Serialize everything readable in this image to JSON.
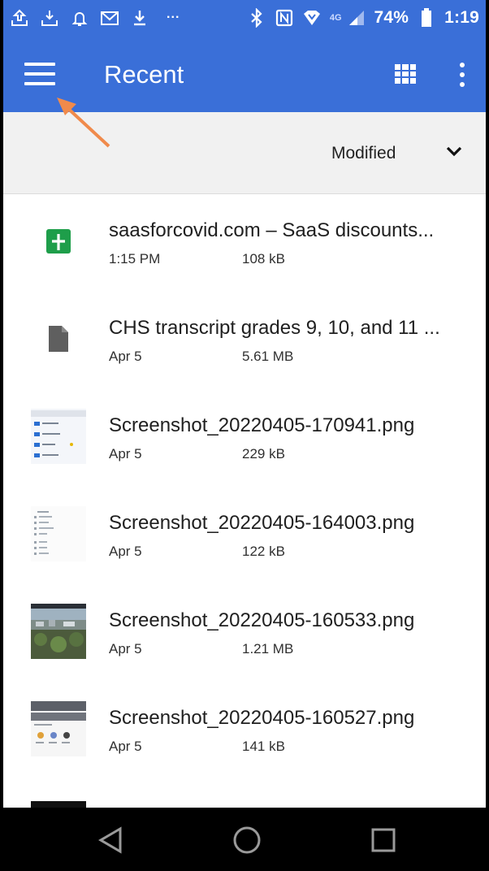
{
  "status_bar": {
    "battery": "74%",
    "time": "1:19",
    "network": "4G",
    "icons": [
      "upload-icon",
      "download-box-icon",
      "bell-icon",
      "gmail-icon",
      "download-icon",
      "more-dots-icon",
      "bluetooth-icon",
      "nfc-icon",
      "location-icon",
      "signal-icon",
      "battery-icon"
    ],
    "overflow_label": "···"
  },
  "app_bar": {
    "title": "Recent",
    "menu_icon": "hamburger-menu-icon",
    "grid_icon": "grid-view-icon",
    "more_icon": "more-vert-icon",
    "color": "#3a6fd8"
  },
  "sort": {
    "label": "Modified",
    "icon": "chevron-down-icon"
  },
  "files": [
    {
      "name": "saasforcovid.com – SaaS discounts...",
      "date": "1:15 PM",
      "size": "108 kB",
      "icon": "google-sheets-icon"
    },
    {
      "name": "CHS transcript grades 9, 10, and 11 ...",
      "date": "Apr 5",
      "size": "5.61 MB",
      "icon": "document-file-icon"
    },
    {
      "name": "Screenshot_20220405-170941.png",
      "date": "Apr 5",
      "size": "229 kB",
      "icon": "image-thumbnail"
    },
    {
      "name": "Screenshot_20220405-164003.png",
      "date": "Apr 5",
      "size": "122 kB",
      "icon": "image-thumbnail"
    },
    {
      "name": "Screenshot_20220405-160533.png",
      "date": "Apr 5",
      "size": "1.21 MB",
      "icon": "image-thumbnail"
    },
    {
      "name": "Screenshot_20220405-160527.png",
      "date": "Apr 5",
      "size": "141 kB",
      "icon": "image-thumbnail"
    }
  ],
  "nav_bar": {
    "back_icon": "back-triangle-icon",
    "home_icon": "home-circle-icon",
    "recents_icon": "recents-square-icon"
  },
  "colors": {
    "accent": "#3a6fd8",
    "sheets_green": "#1e9e4a",
    "annotation_arrow": "#f08a4b"
  }
}
